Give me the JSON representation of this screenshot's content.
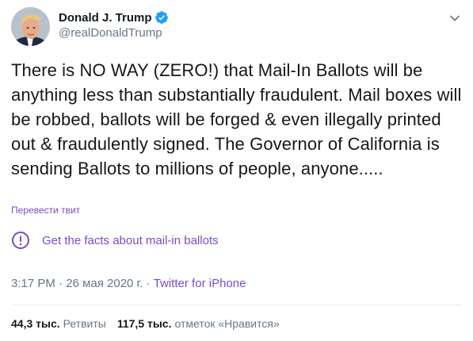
{
  "author": {
    "display_name": "Donald J. Trump",
    "handle": "@realDonaldTrump",
    "verified_icon": "verified-badge-icon"
  },
  "tweet": {
    "text": "There is NO WAY (ZERO!) that Mail-In Ballots will be anything less than substantially fraudulent. Mail boxes will be robbed, ballots will be forged & even illegally printed out & fraudulently signed. The Governor of California is sending Ballots to millions of people, anyone.....",
    "translate_label": "Перевести твит"
  },
  "facts_notice": {
    "icon": "exclamation-circle-icon",
    "label": "Get the facts about mail-in ballots"
  },
  "meta": {
    "time": "3:17 PM",
    "separator": " · ",
    "date": "26 мая 2020 г.",
    "source": "Twitter for iPhone"
  },
  "stats": {
    "retweets_count": "44,3 тыс.",
    "retweets_label": "Ретвиты",
    "likes_count": "117,5 тыс.",
    "likes_label": "отметок «Нравится»"
  },
  "colors": {
    "accent": "#794bc4",
    "verified": "#1da1f2",
    "secondary_text": "#657786"
  }
}
